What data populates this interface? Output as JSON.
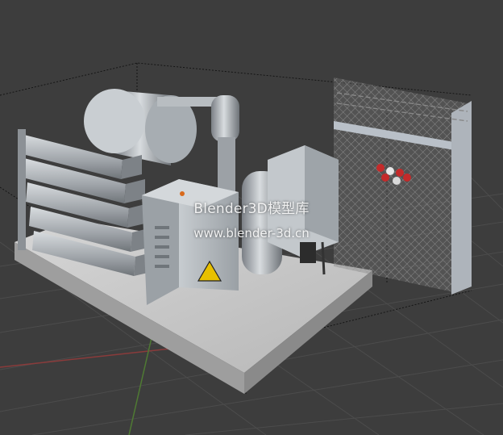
{
  "viewport": {
    "view": "3D viewport",
    "background_color": "#3d3d3d",
    "grid_color": "#505050",
    "axis_x_color": "#8a3b3b",
    "axis_y_color": "#4f7a33"
  },
  "model": {
    "subject": "generator / gas equipment unit on concrete base with chain-link fence panel",
    "base_color": "#c9c9c9",
    "metal_color": "#aeb3b8",
    "warning_sign_color": "#e8c000"
  },
  "watermark": {
    "title": "Blender3D模型库",
    "url": "www.blender-3d.cn"
  }
}
